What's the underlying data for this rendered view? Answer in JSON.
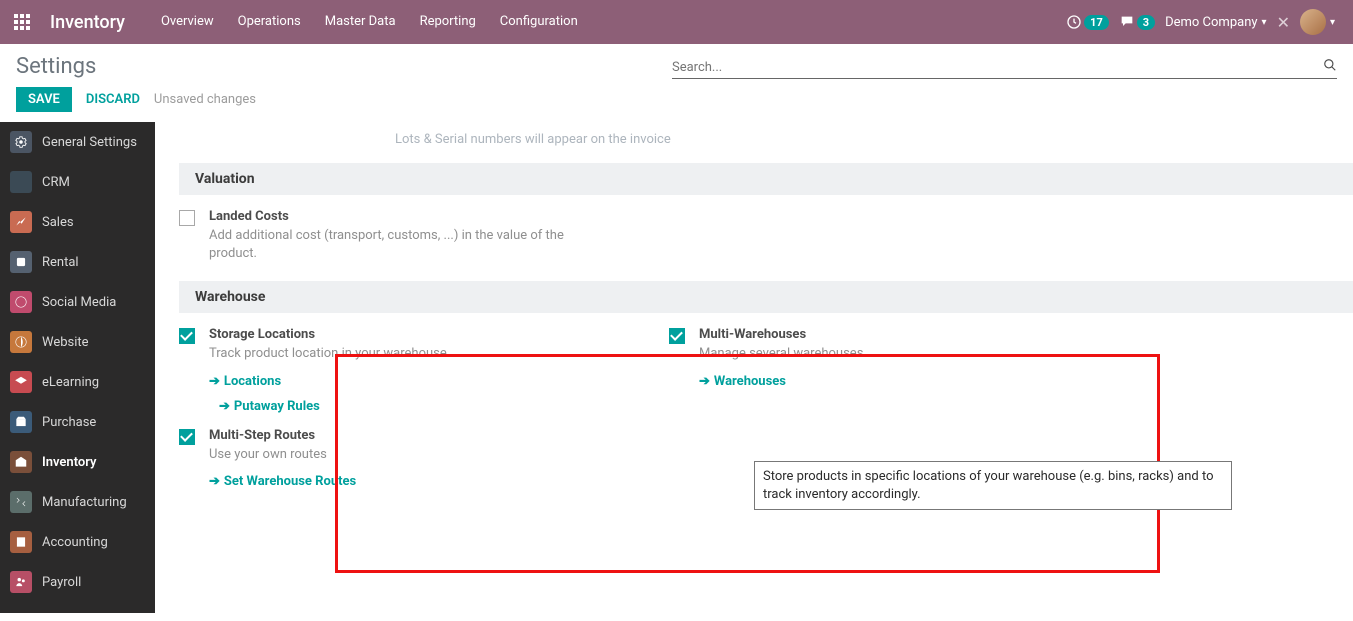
{
  "topnav": {
    "brand": "Inventory",
    "menu": [
      "Overview",
      "Operations",
      "Master Data",
      "Reporting",
      "Configuration"
    ],
    "activity_count": "17",
    "message_count": "3",
    "company": "Demo Company"
  },
  "controlpanel": {
    "title": "Settings",
    "search_placeholder": "Search...",
    "save": "SAVE",
    "discard": "DISCARD",
    "unsaved": "Unsaved changes"
  },
  "sidebar": {
    "items": [
      {
        "label": "General Settings"
      },
      {
        "label": "CRM"
      },
      {
        "label": "Sales"
      },
      {
        "label": "Rental"
      },
      {
        "label": "Social Media"
      },
      {
        "label": "Website"
      },
      {
        "label": "eLearning"
      },
      {
        "label": "Purchase"
      },
      {
        "label": "Inventory"
      },
      {
        "label": "Manufacturing"
      },
      {
        "label": "Accounting"
      },
      {
        "label": "Payroll"
      }
    ]
  },
  "faded_prev": "Lots & Serial numbers will appear on the invoice",
  "sections": {
    "valuation": {
      "title": "Valuation",
      "landed": {
        "label": "Landed Costs",
        "desc": "Add additional cost (transport, customs, ...) in the value of the product."
      }
    },
    "warehouse": {
      "title": "Warehouse",
      "storage": {
        "label": "Storage Locations",
        "desc": "Track product location in your warehouse",
        "link_locations": "Locations",
        "link_putaway": "Putaway Rules"
      },
      "multiwh": {
        "label": "Multi-Warehouses",
        "desc": "Manage several warehouses",
        "link_wh": "Warehouses"
      },
      "routes": {
        "label": "Multi-Step Routes",
        "desc": "Use your own routes",
        "link_routes": "Set Warehouse Routes"
      }
    }
  },
  "tooltip": "Store products in specific locations of your warehouse (e.g. bins, racks) and to track inventory accordingly."
}
